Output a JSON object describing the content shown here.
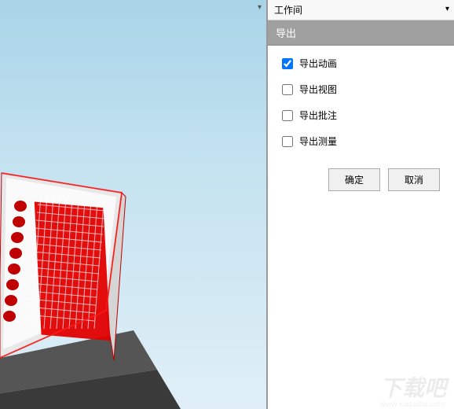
{
  "header": {
    "panel_label": "工作间",
    "help_symbol": "?"
  },
  "export_panel": {
    "title": "导出",
    "options": [
      {
        "label": "导出动画",
        "checked": true
      },
      {
        "label": "导出视图",
        "checked": false
      },
      {
        "label": "导出批注",
        "checked": false
      },
      {
        "label": "导出测量",
        "checked": false
      }
    ],
    "ok_label": "确定",
    "cancel_label": "取消"
  },
  "watermark": {
    "main": "下载吧",
    "sub": "www.xiazaiba.com"
  }
}
